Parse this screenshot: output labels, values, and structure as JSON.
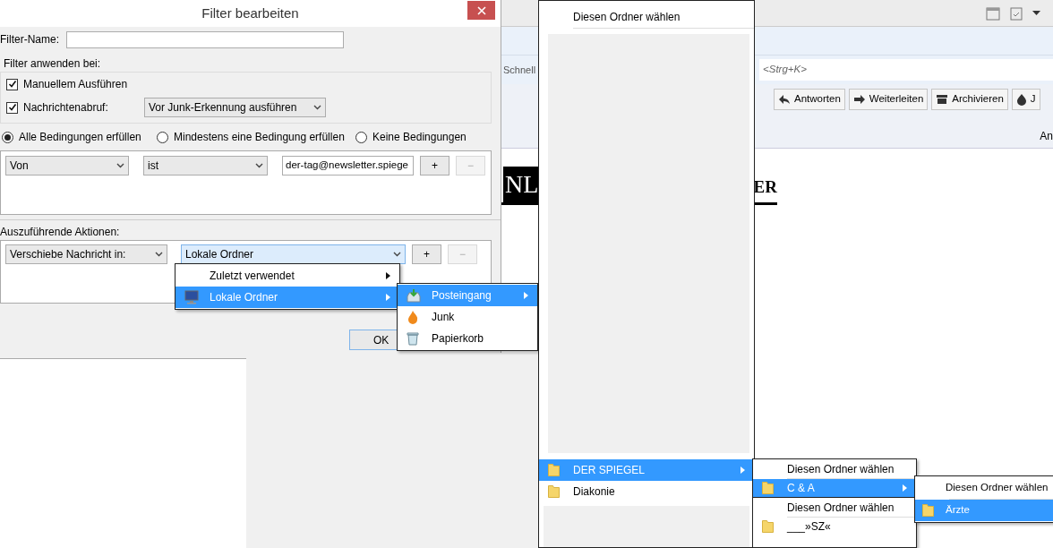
{
  "mail_window": {
    "quick_filter": "Schnell",
    "search": {
      "placeholder": "<Strg+K>"
    },
    "toolbar_buttons": [
      {
        "label": "Antworten",
        "kind": "reply"
      },
      {
        "label": "Weiterleiten",
        "kind": "forward"
      },
      {
        "label": "Archivieren",
        "kind": "archive"
      },
      {
        "label": "J",
        "kind": "junk"
      }
    ],
    "header_text": "An",
    "message": {
      "banner_left": "NL",
      "banner_right": "ER"
    }
  },
  "dialog": {
    "title": "Filter bearbeiten",
    "filter_name": {
      "label": "Filter-Name:"
    },
    "apply_when": {
      "label": "Filter anwenden bei:",
      "options": [
        {
          "label": "Manuellem Ausführen",
          "checked": true
        },
        {
          "label": "Nachrichtenabruf:",
          "checked": true,
          "select": "Vor Junk-Erkennung ausführen"
        }
      ]
    },
    "match": [
      {
        "label": "Alle Bedingungen erfüllen",
        "selected": true
      },
      {
        "label": "Mindestens eine Bedingung erfüllen",
        "selected": false
      },
      {
        "label": "Keine Bedingungen",
        "selected": false
      }
    ],
    "conditions": [
      {
        "field": "Von",
        "operator": "ist",
        "value": "der-tag@newsletter.spiege",
        "add": "+",
        "remove": "−",
        "remove_disabled": true
      }
    ],
    "actions_label": "Auszuführende Aktionen:",
    "actions": [
      {
        "action": "Verschiebe Nachricht in:",
        "target": "Lokale Ordner",
        "open": true,
        "add": "+",
        "remove": "−",
        "remove_disabled": true
      }
    ],
    "ok": "OK"
  },
  "menus": [
    {
      "items": [
        {
          "label": "Zuletzt verwendet",
          "kind": "plain",
          "submenu": true,
          "selected": false
        },
        {
          "label": "Lokale Ordner",
          "kind": "computer",
          "submenu": true,
          "selected": true
        }
      ]
    },
    {
      "items": [
        {
          "label": "Posteingang",
          "kind": "inbox",
          "submenu": true,
          "selected": true
        },
        {
          "label": "Junk",
          "kind": "junk",
          "submenu": false,
          "selected": false
        },
        {
          "label": "Papierkorb",
          "kind": "trash",
          "submenu": false,
          "selected": false
        }
      ]
    },
    {
      "items": [
        {
          "label": "Diesen Ordner wählen",
          "kind": "plain",
          "submenu": false,
          "selected": false
        },
        {
          "label": "DER SPIEGEL",
          "kind": "folder",
          "submenu": true,
          "selected": true
        },
        {
          "label": "Diakonie",
          "kind": "folder",
          "submenu": false,
          "selected": false
        }
      ]
    },
    {
      "items": [
        {
          "label": "Diesen Ordner wählen",
          "kind": "plain",
          "submenu": false,
          "selected": false
        },
        {
          "label": "C & A",
          "kind": "folder",
          "submenu": true,
          "selected": true
        }
      ]
    },
    {
      "items": [
        {
          "label": "Diesen Ordner wählen",
          "kind": "plain",
          "submenu": false,
          "selected": false
        },
        {
          "label": "___»SZ«",
          "kind": "folder",
          "submenu": false,
          "selected": false
        }
      ]
    },
    {
      "items": [
        {
          "label": "Diesen Ordner wählen",
          "kind": "plain",
          "submenu": false,
          "selected": false
        },
        {
          "label": "Ärzte",
          "kind": "folder",
          "submenu": false,
          "selected": true
        }
      ]
    }
  ]
}
